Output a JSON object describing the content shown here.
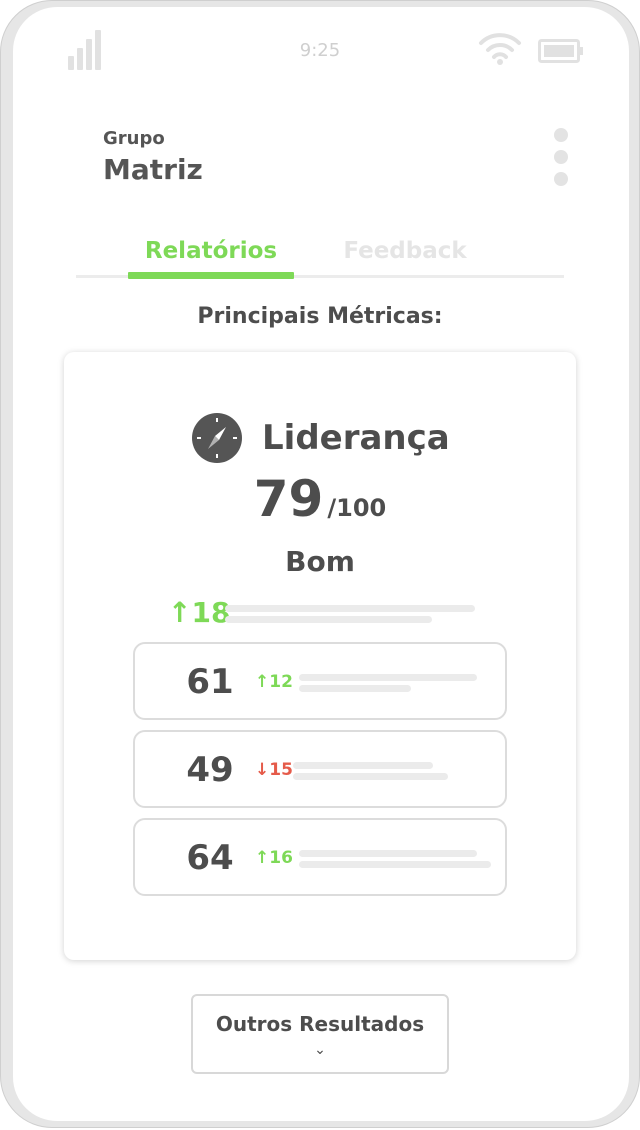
{
  "status_bar": {
    "time": "9:25"
  },
  "header": {
    "group_label": "Grupo",
    "group_name": "Matriz"
  },
  "tabs": [
    {
      "label": "Relatórios",
      "active": true
    },
    {
      "label": "Feedback",
      "active": false
    }
  ],
  "section_title": "Principais Métricas:",
  "metric": {
    "icon": "compass-icon",
    "name": "Liderança",
    "score": "79",
    "score_max": "/100",
    "rating": "Bom",
    "delta": "↑18"
  },
  "sub_metrics": [
    {
      "value": "61",
      "delta": "↑12",
      "direction": "up"
    },
    {
      "value": "49",
      "delta": "↓15",
      "direction": "down"
    },
    {
      "value": "64",
      "delta": "↑16",
      "direction": "up"
    }
  ],
  "more_button": {
    "label": "Outros Resultados",
    "chevron": "⌄"
  },
  "colors": {
    "accent": "#7ed957",
    "negative": "#e55b4a",
    "text": "#4d4d4d"
  }
}
